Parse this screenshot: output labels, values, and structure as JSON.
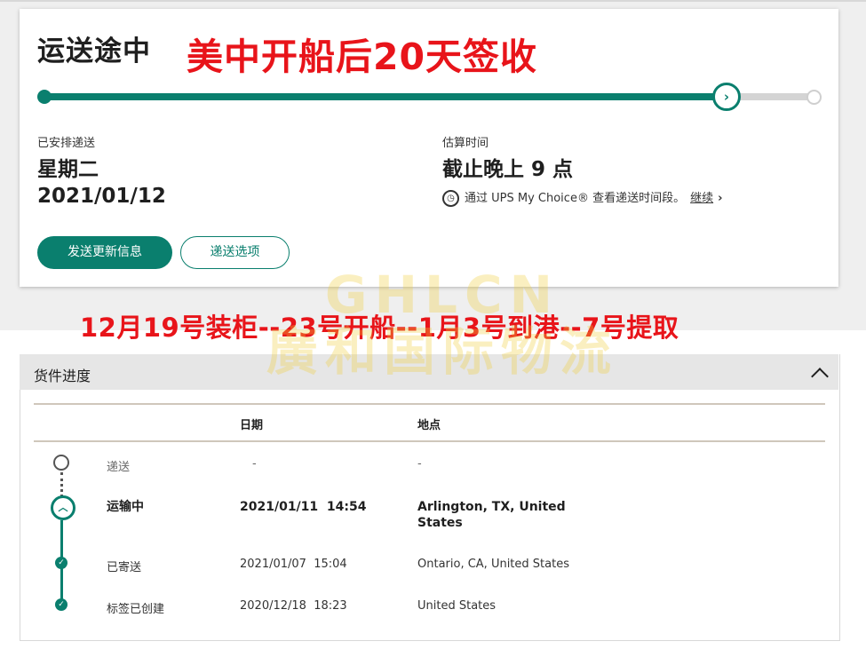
{
  "shipment": {
    "status_title": "运送途中",
    "progress": 0.89
  },
  "overlay": {
    "headline": "美中开船后20天签收",
    "timeline": "12月19号装柜--23号开船--1月3号到港--7号提取",
    "watermark_line1": "GHLCN",
    "watermark_line2": "廣和国际物流"
  },
  "delivery": {
    "scheduled_label": "已安排递送",
    "scheduled_day": "星期二",
    "scheduled_date": "2021/01/12",
    "estimate_label": "估算时间",
    "estimate_value": "截止晚上 9 点",
    "ups_note": "通过 UPS My Choice® 查看递送时间段。",
    "continue_label": "继续"
  },
  "buttons": {
    "send_updates": "发送更新信息",
    "delivery_options": "递送选项"
  },
  "progress_panel": {
    "title": "货件进度",
    "columns": {
      "date": "日期",
      "location": "地点"
    },
    "rows": [
      {
        "status": "递送",
        "date": "-",
        "location": "-"
      },
      {
        "status": "运输中",
        "date": "2021/01/11  14:54",
        "location_line1": "Arlington, TX, United",
        "location_line2": "States"
      },
      {
        "status": "已寄送",
        "date": "2021/01/07  15:04",
        "location": "Ontario, CA, United States"
      },
      {
        "status": "标签已创建",
        "date": "2020/12/18  18:23",
        "location": "United States"
      }
    ]
  },
  "colors": {
    "brand_green": "#0a7f6e",
    "overlay_red": "#e8141a"
  }
}
